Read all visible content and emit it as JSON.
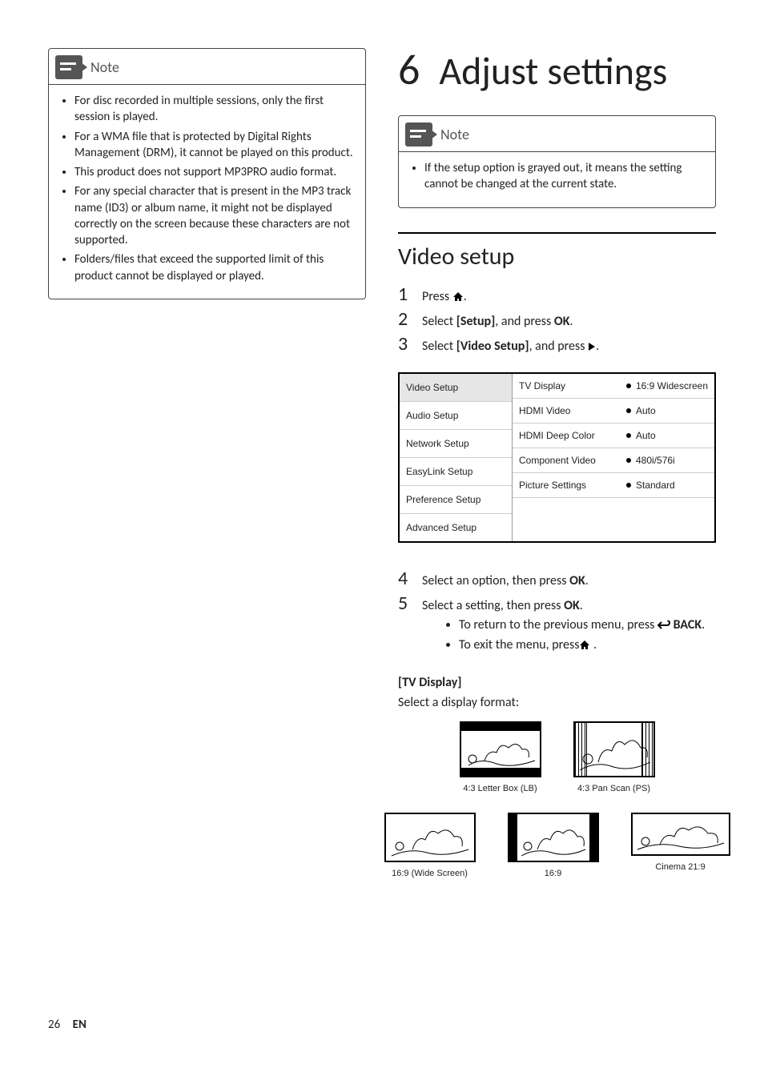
{
  "left_note": {
    "title": "Note",
    "items": [
      "For disc recorded in multiple sessions, only the first session is played.",
      "For a WMA file that is protected by Digital Rights Management (DRM), it cannot be played on this product.",
      "This product does not support MP3PRO audio format.",
      "For any special character that is present in the MP3 track name (ID3) or album name, it might not be displayed correctly on the screen because these characters are not supported.",
      "Folders/files that exceed the supported limit of this product cannot be displayed or played."
    ]
  },
  "chapter": {
    "num": "6",
    "title": "Adjust settings"
  },
  "right_note": {
    "title": "Note",
    "items": [
      "If the setup option is grayed out, it means the setting cannot be changed at the current state."
    ]
  },
  "section": "Video setup",
  "steps123": {
    "s1": {
      "n": "1",
      "t_pre": "Press ",
      "t_post": "."
    },
    "s2": {
      "n": "2",
      "t1": "Select ",
      "b1": "[Setup]",
      "t2": ", and press ",
      "b2": "OK",
      "t3": "."
    },
    "s3": {
      "n": "3",
      "t1": "Select ",
      "b1": "[Video Setup]",
      "t2": ", and press ",
      "t3": "."
    }
  },
  "menu": {
    "left": [
      "Video Setup",
      "Audio Setup",
      "Network Setup",
      "EasyLink Setup",
      "Preference Setup",
      "Advanced Setup"
    ],
    "rows": [
      {
        "opt": "TV Display",
        "val": "16:9 Widescreen"
      },
      {
        "opt": "HDMI Video",
        "val": "Auto"
      },
      {
        "opt": "HDMI Deep Color",
        "val": "Auto"
      },
      {
        "opt": "Component Video",
        "val": "480i/576i"
      },
      {
        "opt": "Picture Settings",
        "val": "Standard"
      }
    ]
  },
  "steps45": {
    "s4": {
      "n": "4",
      "t1": "Select an option, then press ",
      "b1": "OK",
      "t2": "."
    },
    "s5": {
      "n": "5",
      "t1": "Select a setting, then press ",
      "b1": "OK",
      "t2": "."
    },
    "sub1": {
      "t1": "To return to the previous menu, press ",
      "b1": "BACK",
      "t2": "."
    },
    "sub2": {
      "t1": "To exit the menu, press",
      "t2": " ."
    }
  },
  "tvdisplay": {
    "label": "[TV Display]",
    "desc": "Select a display format:",
    "caps": {
      "lb": "4:3 Letter Box (LB)",
      "ps": "4:3 Pan Scan (PS)",
      "ws": "16:9 (Wide Screen)",
      "s169": "16:9",
      "c219": "Cinema 21:9"
    }
  },
  "footer": {
    "page": "26",
    "lang": "EN"
  }
}
